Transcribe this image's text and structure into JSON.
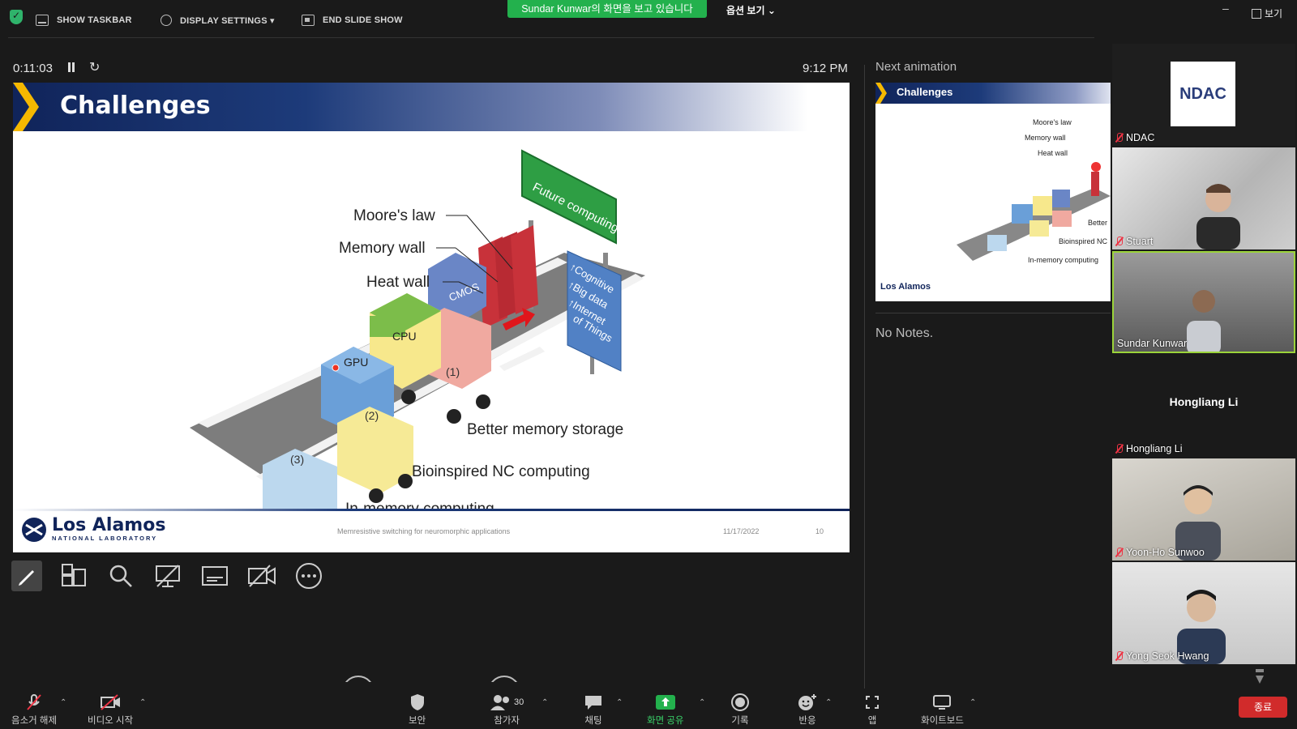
{
  "topbar": {
    "show_taskbar": "SHOW TASKBAR",
    "display_settings": "DISPLAY SETTINGS ▾",
    "end_slide_show": "END SLIDE SHOW",
    "share_banner": "Sundar Kunwar의 화면을 보고 있습니다",
    "options": "옵션 보기 ⌄",
    "minimize": "–",
    "view": "보기"
  },
  "presenter": {
    "timer": "0:11:03",
    "clock": "9:12 PM",
    "next_label": "Next animation",
    "notes": "No Notes."
  },
  "slide": {
    "title": "Challenges",
    "moores_law": "Moore's law",
    "memory_wall": "Memory wall",
    "heat_wall": "Heat wall",
    "future_sign": "Future computing",
    "cpu": "CPU",
    "gpu": "GPU",
    "cmos": "CMOS",
    "car1": "(1)",
    "car2": "(2)",
    "car3": "(3)",
    "cognitive": "↑Cognitive",
    "big_data": "↑Big data",
    "internet": "↑Internet",
    "of_things": "of Things",
    "better_memory": "Better memory storage",
    "bioinspired": "Bioinspired NC computing",
    "in_memory": "In-memory computing",
    "logo_name": "Los Alamos",
    "logo_sub": "NATIONAL LABORATORY",
    "footer_text": "Memresistive switching for neuromorphic applications",
    "date": "11/17/2022",
    "page": "10"
  },
  "mini_slide": {
    "title": "Challenges",
    "moores_law": "Moore's law",
    "memory_wall": "Memory wall",
    "heat_wall": "Heat wall",
    "better": "Better",
    "bioinspired": "Bioinspired NC",
    "in_memory": "In-memory computing",
    "logo_name": "Los Alamos"
  },
  "participants": [
    {
      "name": "NDAC",
      "logo": "NDAC"
    },
    {
      "name": "Stuart"
    },
    {
      "name": "Sundar Kunwar"
    },
    {
      "name": "Hongliang Li",
      "display": "Hongliang Li"
    },
    {
      "name": "Yoon-Ho Sunwoo"
    },
    {
      "name": "Yong Seok Hwang"
    }
  ],
  "bottombar": {
    "unmute": "음소거 해제",
    "start_video": "비디오 시작",
    "security": "보안",
    "participants": "참가자",
    "participant_count": "30",
    "chat": "채팅",
    "share_screen": "화면 공유",
    "record": "기록",
    "reactions": "반응",
    "apps": "앱",
    "whiteboard": "화이트보드",
    "end": "종료"
  },
  "colors": {
    "share_green": "#23b14d",
    "end_red": "#d12b2b",
    "lanl_navy": "#10245a",
    "chevron_gold": "#f5b800"
  }
}
